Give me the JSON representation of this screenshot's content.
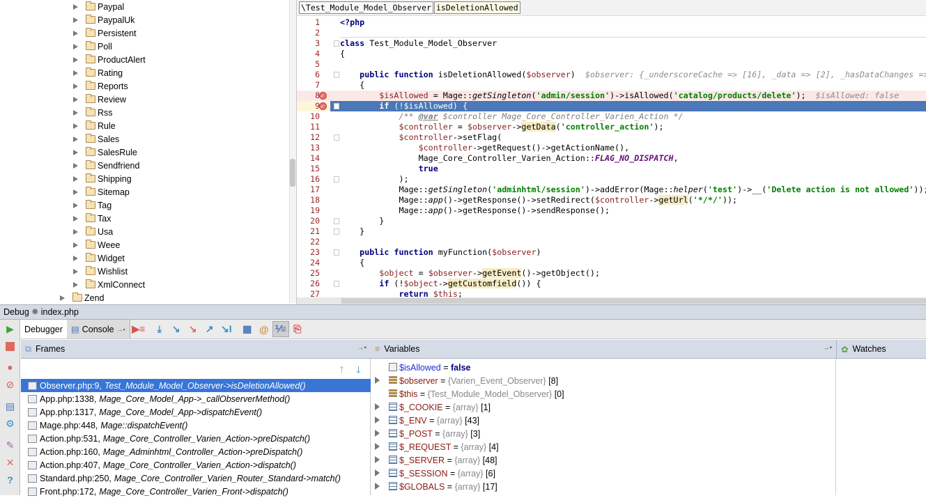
{
  "project_tree": {
    "items": [
      "Paypal",
      "PaypalUk",
      "Persistent",
      "Poll",
      "ProductAlert",
      "Rating",
      "Reports",
      "Review",
      "Rss",
      "Rule",
      "Sales",
      "SalesRule",
      "Sendfriend",
      "Shipping",
      "Sitemap",
      "Tag",
      "Tax",
      "Usa",
      "Weee",
      "Widget",
      "Wishlist",
      "XmlConnect"
    ],
    "parent_item": "Zend"
  },
  "editor": {
    "breadcrumbs": [
      "\\Test_Module_Model_Observer",
      "isDeletionAllowed"
    ],
    "breakpoint_lines": [
      8,
      9
    ],
    "current_line": 9,
    "lines": [
      [
        [
          "<?php",
          "kw"
        ]
      ],
      [],
      [
        [
          "class",
          "kw"
        ],
        [
          " Test_Module_Model_Observer",
          ""
        ]
      ],
      [
        [
          "{",
          ""
        ]
      ],
      [],
      [
        [
          "    ",
          ""
        ],
        [
          "public function",
          "kw"
        ],
        [
          " isDeletionAllowed(",
          ""
        ],
        [
          "$observer",
          "var"
        ],
        [
          ")",
          ""
        ],
        [
          "  $observer: {_underscoreCache => [16], _data => [2], _hasDataChanges => ",
          "hint"
        ]
      ],
      [
        [
          "    {",
          ""
        ]
      ],
      [
        [
          "        ",
          ""
        ],
        [
          "$isAllowed",
          "var"
        ],
        [
          " = Mage::",
          ""
        ],
        [
          "getSingleton",
          "it"
        ],
        [
          "(",
          ""
        ],
        [
          "'admin/session'",
          "str"
        ],
        [
          ")->isAllowed(",
          ""
        ],
        [
          "'catalog/products/delete'",
          "str"
        ],
        [
          ");",
          ""
        ],
        [
          "  $isAllowed: false",
          "hint"
        ]
      ],
      [
        [
          "        ",
          ""
        ],
        [
          "if",
          "kw"
        ],
        [
          " (!",
          ""
        ],
        [
          "$isAllowed",
          "var"
        ],
        [
          ") {",
          ""
        ]
      ],
      [
        [
          "            ",
          ""
        ],
        [
          "/** ",
          "cmt"
        ],
        [
          "@var",
          "cmtu"
        ],
        [
          " $controller Mage_Core_Controller_Varien_Action */",
          "cmt"
        ]
      ],
      [
        [
          "            ",
          ""
        ],
        [
          "$controller",
          "var"
        ],
        [
          " = ",
          ""
        ],
        [
          "$observer",
          "var"
        ],
        [
          "->",
          ""
        ],
        [
          "getData",
          "hl"
        ],
        [
          "(",
          ""
        ],
        [
          "'controller_action'",
          "str"
        ],
        [
          ");",
          ""
        ]
      ],
      [
        [
          "            ",
          ""
        ],
        [
          "$controller",
          "var"
        ],
        [
          "->setFlag(",
          ""
        ]
      ],
      [
        [
          "                ",
          ""
        ],
        [
          "$controller",
          "var"
        ],
        [
          "->getRequest()->getActionName(),",
          ""
        ]
      ],
      [
        [
          "                Mage_Core_Controller_Varien_Action::",
          ""
        ],
        [
          "FLAG_NO_DISPATCH",
          "const"
        ],
        [
          ",",
          ""
        ]
      ],
      [
        [
          "                ",
          ""
        ],
        [
          "true",
          "kw"
        ]
      ],
      [
        [
          "            );",
          ""
        ]
      ],
      [
        [
          "            Mage::",
          ""
        ],
        [
          "getSingleton",
          "it"
        ],
        [
          "(",
          ""
        ],
        [
          "'adminhtml/session'",
          "str"
        ],
        [
          ")->addError(Mage::",
          ""
        ],
        [
          "helper",
          "it"
        ],
        [
          "(",
          ""
        ],
        [
          "'test'",
          "str"
        ],
        [
          ")->__(",
          ""
        ],
        [
          "'Delete action is not allowed'",
          "str"
        ],
        [
          "));",
          ""
        ]
      ],
      [
        [
          "            Mage::",
          ""
        ],
        [
          "app",
          "it"
        ],
        [
          "()->getResponse()->setRedirect(",
          ""
        ],
        [
          "$controller",
          "var"
        ],
        [
          "->",
          ""
        ],
        [
          "getUrl",
          "hl"
        ],
        [
          "(",
          ""
        ],
        [
          "'*/*/'",
          "str"
        ],
        [
          "));",
          ""
        ]
      ],
      [
        [
          "            Mage::",
          ""
        ],
        [
          "app",
          "it"
        ],
        [
          "()->getResponse()->sendResponse();",
          ""
        ]
      ],
      [
        [
          "        }",
          ""
        ]
      ],
      [
        [
          "    }",
          ""
        ]
      ],
      [],
      [
        [
          "    ",
          ""
        ],
        [
          "public function",
          "kw"
        ],
        [
          " myFunction(",
          ""
        ],
        [
          "$observer",
          "var"
        ],
        [
          ")",
          ""
        ]
      ],
      [
        [
          "    {",
          ""
        ]
      ],
      [
        [
          "        ",
          ""
        ],
        [
          "$object",
          "var"
        ],
        [
          " = ",
          ""
        ],
        [
          "$observer",
          "var"
        ],
        [
          "->",
          ""
        ],
        [
          "getEvent",
          "hl"
        ],
        [
          "()->getObject();",
          ""
        ]
      ],
      [
        [
          "        ",
          ""
        ],
        [
          "if",
          "kw"
        ],
        [
          " (!",
          ""
        ],
        [
          "$object",
          "var"
        ],
        [
          "->",
          ""
        ],
        [
          "getCustomfield",
          "hl"
        ],
        [
          "()) {",
          ""
        ]
      ],
      [
        [
          "            ",
          ""
        ],
        [
          "return",
          "kw"
        ],
        [
          " ",
          ""
        ],
        [
          "$this",
          "var"
        ],
        [
          ";",
          ""
        ]
      ],
      [
        [
          "        }",
          ""
        ]
      ]
    ]
  },
  "debug": {
    "title": "Debug",
    "config": "index.php",
    "tabs": {
      "debugger": "Debugger",
      "console": "Console"
    },
    "frames_title": "Frames",
    "variables_title": "Variables",
    "watches_title": "Watches",
    "frames": [
      {
        "file": "Observer.php:9,",
        "method": "Test_Module_Model_Observer->isDeletionAllowed()"
      },
      {
        "file": "App.php:1338,",
        "method": "Mage_Core_Model_App->_callObserverMethod()"
      },
      {
        "file": "App.php:1317,",
        "method": "Mage_Core_Model_App->dispatchEvent()"
      },
      {
        "file": "Mage.php:448,",
        "method": "Mage::dispatchEvent()"
      },
      {
        "file": "Action.php:531,",
        "method": "Mage_Core_Controller_Varien_Action->preDispatch()"
      },
      {
        "file": "Action.php:160,",
        "method": "Mage_Adminhtml_Controller_Action->preDispatch()"
      },
      {
        "file": "Action.php:407,",
        "method": "Mage_Core_Controller_Varien_Action->dispatch()"
      },
      {
        "file": "Standard.php:250,",
        "method": "Mage_Core_Controller_Varien_Router_Standard->match()"
      },
      {
        "file": "Front.php:172,",
        "method": "Mage_Core_Controller_Varien_Front->dispatch()"
      }
    ],
    "variables": [
      {
        "icon": "bool",
        "name": "$isAllowed",
        "eq": " = ",
        "value": "false",
        "type": "",
        "count": "",
        "expandable": false
      },
      {
        "icon": "object",
        "name": "$observer",
        "eq": " = ",
        "value": "",
        "type": "{Varien_Event_Observer}",
        "count": " [8]",
        "expandable": true
      },
      {
        "icon": "object",
        "name": "$this",
        "eq": " = ",
        "value": "",
        "type": "{Test_Module_Model_Observer}",
        "count": " [0]",
        "expandable": false
      },
      {
        "icon": "array",
        "name": "$_COOKIE",
        "eq": " = ",
        "value": "",
        "type": "{array}",
        "count": " [1]",
        "expandable": true
      },
      {
        "icon": "array",
        "name": "$_ENV",
        "eq": " = ",
        "value": "",
        "type": "{array}",
        "count": " [43]",
        "expandable": true
      },
      {
        "icon": "array",
        "name": "$_POST",
        "eq": " = ",
        "value": "",
        "type": "{array}",
        "count": " [3]",
        "expandable": true
      },
      {
        "icon": "array",
        "name": "$_REQUEST",
        "eq": " = ",
        "value": "",
        "type": "{array}",
        "count": " [4]",
        "expandable": true
      },
      {
        "icon": "array",
        "name": "$_SERVER",
        "eq": " = ",
        "value": "",
        "type": "{array}",
        "count": " [48]",
        "expandable": true
      },
      {
        "icon": "array",
        "name": "$_SESSION",
        "eq": " = ",
        "value": "",
        "type": "{array}",
        "count": " [6]",
        "expandable": true
      },
      {
        "icon": "array",
        "name": "$GLOBALS",
        "eq": " = ",
        "value": "",
        "type": "{array}",
        "count": " [17]",
        "expandable": true
      }
    ]
  },
  "colors": {
    "selection": "#3875d7",
    "current_line": "#4a78b8",
    "breakpoint_line": "#fbe9e8"
  }
}
